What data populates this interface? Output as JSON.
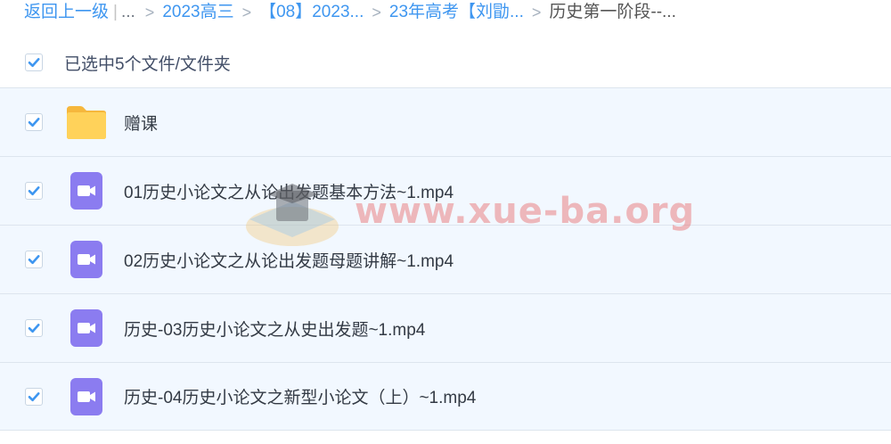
{
  "breadcrumb": {
    "back_label": "返回上一级",
    "separator_bar": "|",
    "ellipsis": "...",
    "separator": ">",
    "items": [
      {
        "label": "2023高三"
      },
      {
        "label": "【08】2023..."
      },
      {
        "label": "23年高考【刘勖..."
      },
      {
        "label": "历史第一阶段--..."
      }
    ]
  },
  "selection": {
    "summary": "已选中5个文件/文件夹",
    "checked": true
  },
  "files": [
    {
      "name": "赠课",
      "type": "folder",
      "icon": "folder-icon",
      "checked": true
    },
    {
      "name": "01历史小论文之从论出发题基本方法~1.mp4",
      "type": "video",
      "icon": "video-file-icon",
      "checked": true
    },
    {
      "name": "02历史小论文之从论出发题母题讲解~1.mp4",
      "type": "video",
      "icon": "video-file-icon",
      "checked": true
    },
    {
      "name": "历史-03历史小论文之从史出发题~1.mp4",
      "type": "video",
      "icon": "video-file-icon",
      "checked": true
    },
    {
      "name": "历史-04历史小论文之新型小论文（上）~1.mp4",
      "type": "video",
      "icon": "video-file-icon",
      "checked": true
    }
  ],
  "watermark": {
    "text": "www.xue-ba.org"
  },
  "colors": {
    "link": "#3e96f0",
    "check": "#3e96f0",
    "row_selected_bg": "#f2f8ff",
    "folder": "#ffc94a",
    "video_icon": "#8b7cf0",
    "watermark": "#e85c5c"
  }
}
